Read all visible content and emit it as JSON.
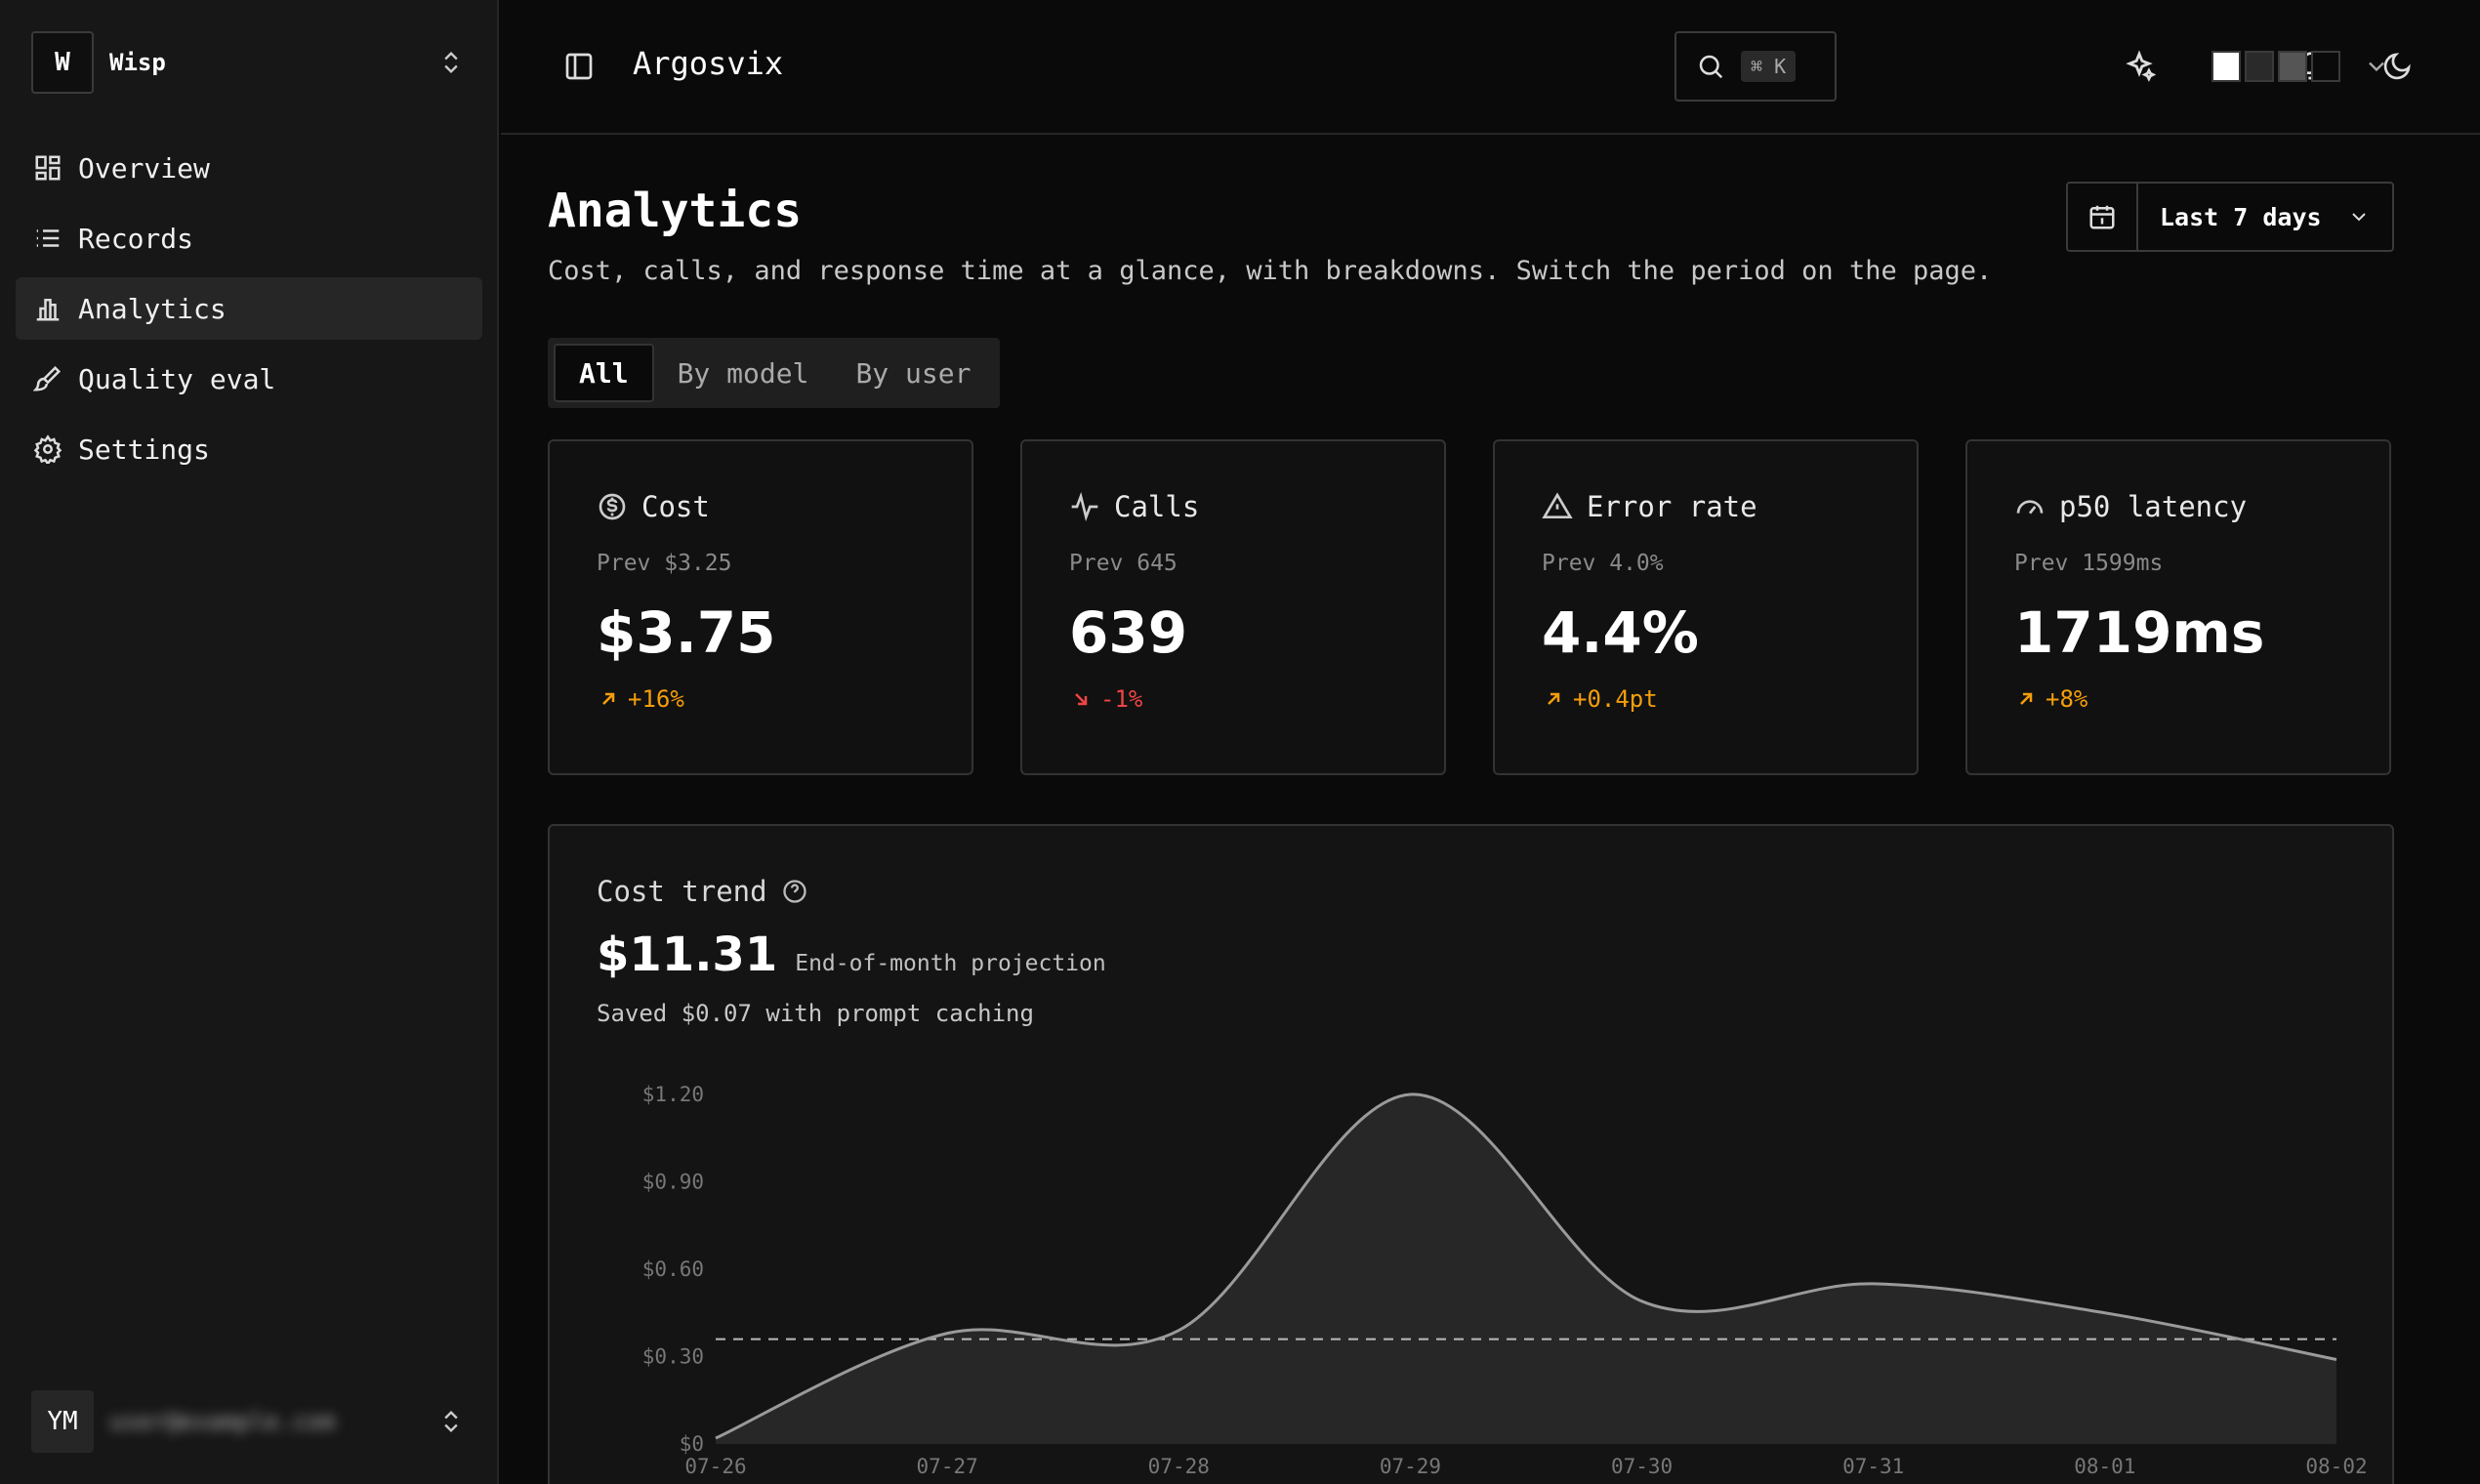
{
  "sidebar": {
    "workspace": {
      "logo": "W",
      "name": "Wisp"
    },
    "items": [
      {
        "label": "Overview",
        "icon": "dashboard-icon",
        "active": false
      },
      {
        "label": "Records",
        "icon": "list-icon",
        "active": false
      },
      {
        "label": "Analytics",
        "icon": "bar-chart-icon",
        "active": true
      },
      {
        "label": "Quality eval",
        "icon": "brush-icon",
        "active": false
      },
      {
        "label": "Settings",
        "icon": "gear-icon",
        "active": false
      }
    ],
    "user": {
      "initials": "YM",
      "email": "user@example.com"
    }
  },
  "header": {
    "title": "Argosvix",
    "search_shortcut": "⌘ K",
    "swatches": [
      "#ffffff",
      "#2a2a2a",
      "#555555",
      "#0a0a0a"
    ]
  },
  "page": {
    "title": "Analytics",
    "subtitle": "Cost, calls, and response time at a glance, with breakdowns. Switch the period on the page.",
    "period": "Last 7 days",
    "tabs": [
      {
        "label": "All",
        "active": true
      },
      {
        "label": "By model",
        "active": false
      },
      {
        "label": "By user",
        "active": false
      }
    ]
  },
  "metrics": [
    {
      "title": "Cost",
      "icon": "dollar-icon",
      "prev": "Prev $3.25",
      "value": "$3.75",
      "delta": "+16%",
      "direction": "up",
      "color": "#f59e0b"
    },
    {
      "title": "Calls",
      "icon": "activity-icon",
      "prev": "Prev 645",
      "value": "639",
      "delta": "-1%",
      "direction": "down",
      "color": "#ef4444"
    },
    {
      "title": "Error rate",
      "icon": "warning-icon",
      "prev": "Prev 4.0%",
      "value": "4.4%",
      "delta": "+0.4pt",
      "direction": "up",
      "color": "#f59e0b"
    },
    {
      "title": "p50 latency",
      "icon": "gauge-icon",
      "prev": "Prev 1599ms",
      "value": "1719ms",
      "delta": "+8%",
      "direction": "up",
      "color": "#f59e0b"
    }
  ],
  "cost_trend": {
    "title": "Cost trend",
    "projection": "$11.31",
    "projection_label": "End-of-month projection",
    "saved": "Saved $0.07 with prompt caching"
  },
  "chart_data": {
    "type": "area",
    "title": "Cost trend",
    "x": [
      "07-26",
      "07-27",
      "07-28",
      "07-29",
      "07-30",
      "07-31",
      "08-01",
      "08-02"
    ],
    "values": [
      0.02,
      0.38,
      0.39,
      1.2,
      0.49,
      0.55,
      0.45,
      0.29
    ],
    "average": 0.36,
    "ylim": [
      0,
      1.2
    ],
    "yticks": [
      0,
      0.3,
      0.6,
      0.9,
      1.2
    ],
    "ytick_labels": [
      "$0",
      "$0.30",
      "$0.60",
      "$0.90",
      "$1.20"
    ],
    "line_color": "#9a9a9a",
    "fill_color": "#2a2a2a",
    "grid": false
  }
}
